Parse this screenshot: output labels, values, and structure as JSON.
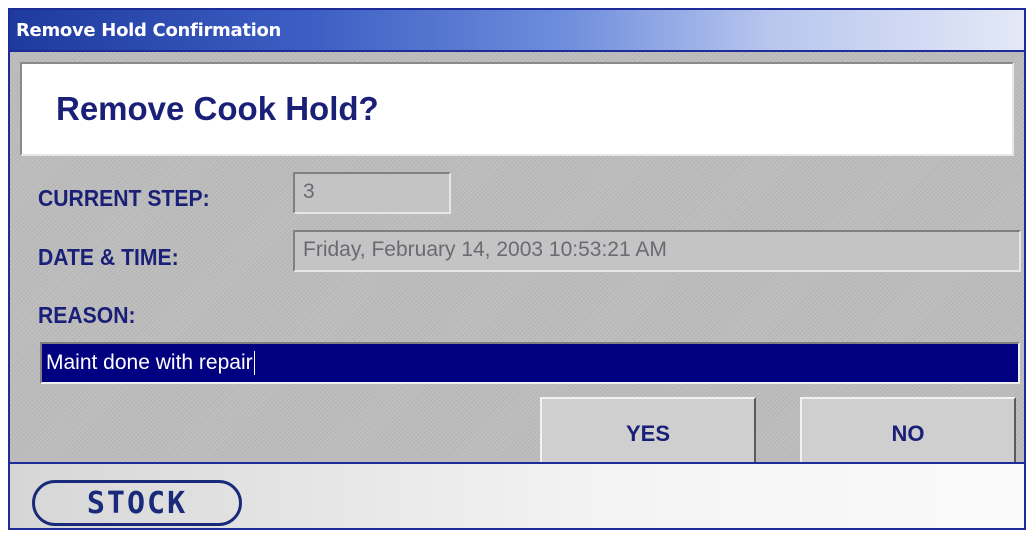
{
  "window": {
    "title": "Remove Hold Confirmation"
  },
  "dialog": {
    "heading": "Remove Cook Hold?",
    "current_step_label": "CURRENT STEP:",
    "current_step_value": "3",
    "date_time_label": "DATE & TIME:",
    "date_time_value": "Friday, February 14, 2003  10:53:21 AM",
    "reason_label": "REASON:",
    "reason_value": "Maint done with repair"
  },
  "buttons": {
    "yes_label": "YES",
    "no_label": "NO"
  },
  "footer": {
    "logo_text": "STOCK"
  },
  "colors": {
    "title_bar": "#1e3a9e",
    "label_text": "#1a1f78",
    "input_background": "#000080",
    "panel_background": "#bdbdbd"
  }
}
